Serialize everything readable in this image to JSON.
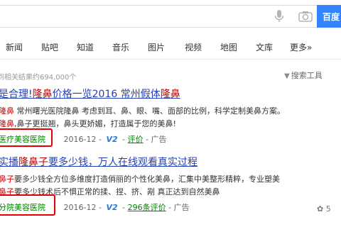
{
  "search": {
    "query": "",
    "button_label": "百度"
  },
  "tabs": [
    "新闻",
    "贴吧",
    "知道",
    "音乐",
    "图片",
    "视频",
    "地图",
    "文库",
    "更多»"
  ],
  "result_count": "到相关结果约694,000个",
  "search_tools": "搜索工具",
  "results": [
    {
      "title_pre": "是合理!",
      "title_hl1": "隆鼻",
      "title_mid": "价格一览2016 常州假体",
      "title_hl2": "隆鼻",
      "line1_hl": "隆鼻",
      "line1": " 常州曙光医院隆鼻 考虑到耳、鼻、眼、嘴、面部的比例，科学定制美鼻方案。",
      "line2_pre": "",
      "line2_hl": "隆鼻",
      "line2": ",鼻子更挺翘，鼻头更娇媚，打造属于您的美鼻!",
      "source": "医疗美容医院",
      "date": "2016-12",
      "badge": "V2",
      "eval": "评价",
      "ad": "广告"
    },
    {
      "title_pre": "实播",
      "title_hl1": "隆鼻子",
      "title_mid": "要多少钱，万人在线观看真实过程",
      "title_hl2": "",
      "line1_hl": "鼻子",
      "line1": "要多少钱全方位多维度打造俏丽的个性化美鼻，汇集中美整形精粹，专业塑美",
      "line2_pre": "",
      "line2_hl": "鼻子",
      "line2": "要多少钱术后不惧正常的揉、捏、挤、剐 真正达到自然美鼻",
      "source": "分院美容医院",
      "date": "2016-12",
      "badge": "V2",
      "eval": "296条评价",
      "ad": "广告"
    }
  ],
  "watermark": "5"
}
